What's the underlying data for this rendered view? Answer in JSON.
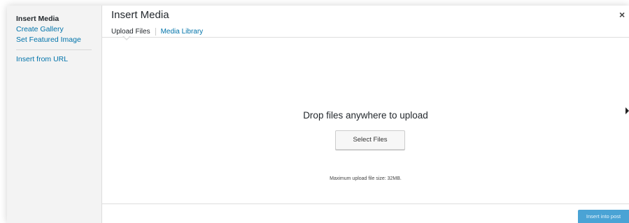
{
  "sidebar": {
    "items": [
      {
        "label": "Insert Media",
        "active": true
      },
      {
        "label": "Create Gallery"
      },
      {
        "label": "Set Featured Image"
      },
      {
        "label": "Insert from URL"
      }
    ]
  },
  "header": {
    "title": "Insert Media",
    "close_glyph": "×",
    "tabs": [
      {
        "label": "Upload Files",
        "active": true
      },
      {
        "label": "Media Library"
      }
    ]
  },
  "uploader": {
    "drop_text": "Drop files anywhere to upload",
    "select_button": "Select Files",
    "max_size_text": "Maximum upload file size: 32MB."
  },
  "footer": {
    "insert_button": "Insert into post"
  },
  "colors": {
    "link": "#0073aa",
    "primary_button": "#4aa3d5",
    "sidebar_bg": "#f3f3f3"
  }
}
